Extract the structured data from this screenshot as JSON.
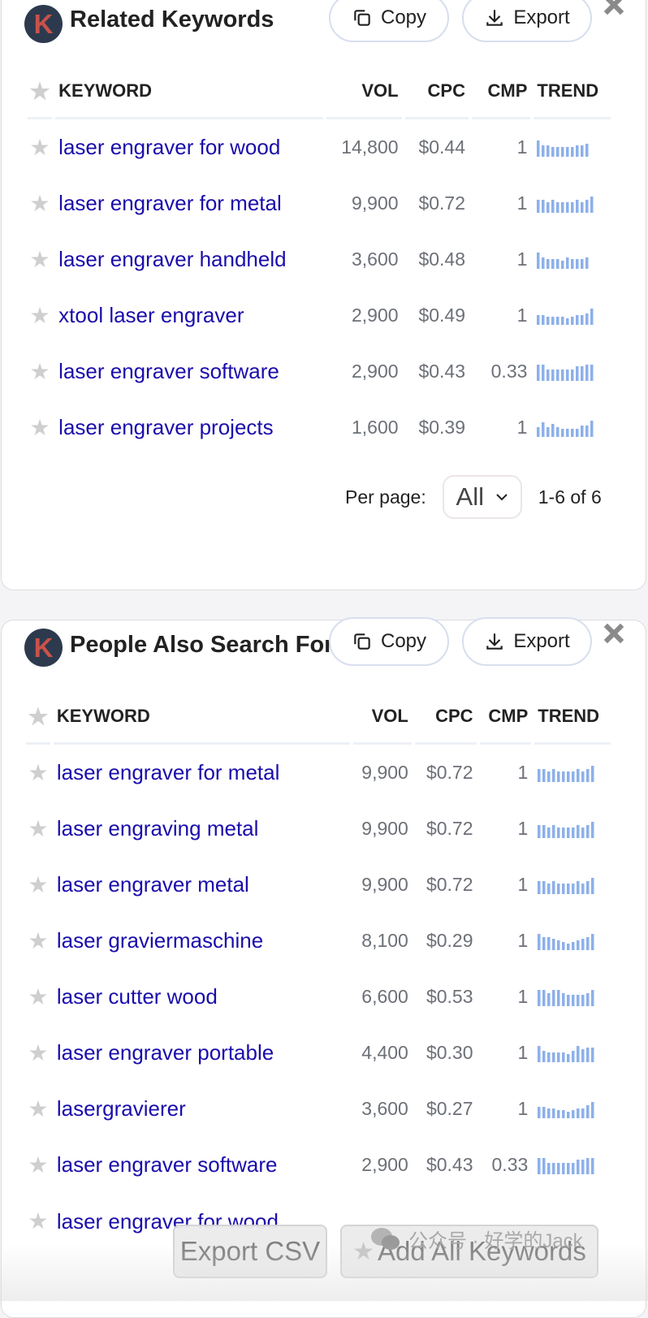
{
  "related": {
    "title": "Related Keywords",
    "logo_letter": "K",
    "copy_label": "Copy",
    "export_label": "Export",
    "columns": {
      "keyword": "KEYWORD",
      "vol": "VOL",
      "cpc": "CPC",
      "cmp": "CMP",
      "trend": "TREND"
    },
    "rows": [
      {
        "keyword": "laser engraver for wood",
        "vol": "14,800",
        "cpc": "$0.44",
        "cmp": "1",
        "trend": [
          10,
          7,
          7,
          6,
          6,
          6,
          6,
          6,
          7,
          7,
          8
        ]
      },
      {
        "keyword": "laser engraver for metal",
        "vol": "9,900",
        "cpc": "$0.72",
        "cmp": "1",
        "trend": [
          7,
          7,
          6,
          7,
          6,
          6,
          6,
          6,
          7,
          6,
          7,
          9
        ]
      },
      {
        "keyword": "laser engraver handheld",
        "vol": "3,600",
        "cpc": "$0.48",
        "cmp": "1",
        "trend": [
          10,
          7,
          6,
          6,
          6,
          5,
          7,
          6,
          6,
          6,
          7
        ]
      },
      {
        "keyword": "xtool laser engraver",
        "vol": "2,900",
        "cpc": "$0.49",
        "cmp": "1",
        "trend": [
          6,
          6,
          5,
          5,
          5,
          5,
          4,
          5,
          6,
          6,
          7,
          10
        ]
      },
      {
        "keyword": "laser engraver software",
        "vol": "2,900",
        "cpc": "$0.43",
        "cmp": "0.33",
        "trend": [
          10,
          10,
          7,
          7,
          7,
          7,
          7,
          7,
          9,
          9,
          10,
          10
        ]
      },
      {
        "keyword": "laser engraver projects",
        "vol": "1,600",
        "cpc": "$0.39",
        "cmp": "1",
        "trend": [
          6,
          9,
          6,
          8,
          6,
          5,
          5,
          5,
          5,
          7,
          7,
          10
        ]
      }
    ],
    "pager": {
      "per_page_label": "Per page:",
      "per_page_value": "All",
      "range": "1-6 of 6"
    }
  },
  "people_also": {
    "title": "People Also Search For",
    "logo_letter": "K",
    "copy_label": "Copy",
    "export_label": "Export",
    "columns": {
      "keyword": "KEYWORD",
      "vol": "VOL",
      "cpc": "CPC",
      "cmp": "CMP",
      "trend": "TREND"
    },
    "rows": [
      {
        "keyword": "laser engraver for metal",
        "vol": "9,900",
        "cpc": "$0.72",
        "cmp": "1",
        "trend": [
          7,
          7,
          6,
          7,
          6,
          6,
          6,
          6,
          7,
          6,
          7,
          9
        ]
      },
      {
        "keyword": "laser engraving metal",
        "vol": "9,900",
        "cpc": "$0.72",
        "cmp": "1",
        "trend": [
          7,
          7,
          6,
          7,
          6,
          6,
          6,
          6,
          7,
          6,
          7,
          9
        ]
      },
      {
        "keyword": "laser engraver metal",
        "vol": "9,900",
        "cpc": "$0.72",
        "cmp": "1",
        "trend": [
          7,
          7,
          6,
          7,
          6,
          6,
          6,
          6,
          7,
          6,
          7,
          9
        ]
      },
      {
        "keyword": "laser graviermaschine",
        "vol": "8,100",
        "cpc": "$0.29",
        "cmp": "1",
        "trend": [
          10,
          8,
          8,
          7,
          6,
          5,
          4,
          5,
          6,
          7,
          8,
          10
        ]
      },
      {
        "keyword": "laser cutter wood",
        "vol": "6,600",
        "cpc": "$0.53",
        "cmp": "1",
        "trend": [
          10,
          10,
          8,
          10,
          10,
          8,
          7,
          7,
          7,
          7,
          8,
          10
        ]
      },
      {
        "keyword": "laser engraver portable",
        "vol": "4,400",
        "cpc": "$0.30",
        "cmp": "1",
        "trend": [
          10,
          7,
          6,
          6,
          6,
          6,
          5,
          7,
          10,
          8,
          9,
          9
        ]
      },
      {
        "keyword": "lasergravierer",
        "vol": "3,600",
        "cpc": "$0.27",
        "cmp": "1",
        "trend": [
          7,
          7,
          6,
          6,
          5,
          5,
          4,
          5,
          6,
          6,
          8,
          10
        ]
      },
      {
        "keyword": "laser engraver software",
        "vol": "2,900",
        "cpc": "$0.43",
        "cmp": "0.33",
        "trend": [
          10,
          10,
          7,
          7,
          7,
          7,
          7,
          7,
          9,
          9,
          10,
          10
        ]
      },
      {
        "keyword": "laser engraver for wood",
        "vol": "",
        "cpc": "",
        "cmp": "",
        "trend": []
      }
    ]
  },
  "overlay": {
    "export_csv_label": "Export CSV",
    "add_all_label": "Add All Keywords",
    "watermark": "公众号 · 好学的Jack"
  },
  "colors": {
    "link": "#1a0dab",
    "trend_bar": "#8db0ea",
    "logo_bg": "#2d3a4e",
    "logo_fg": "#c9524a"
  }
}
